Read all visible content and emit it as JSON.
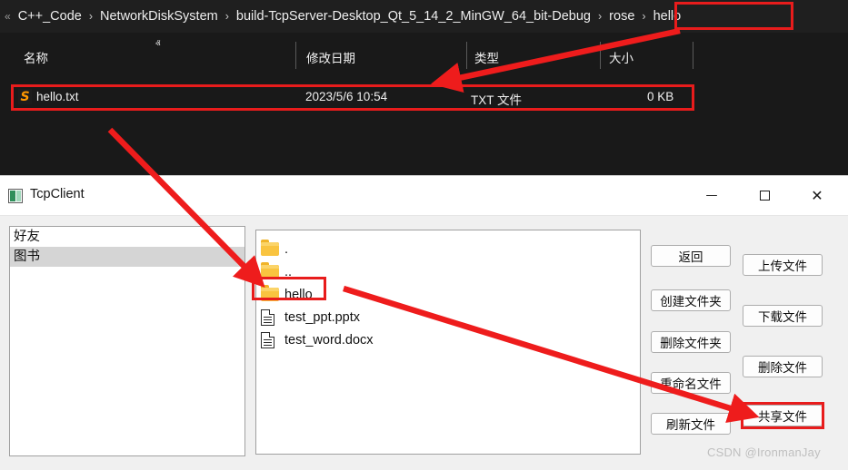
{
  "explorer": {
    "breadcrumb": {
      "overflow_glyph": "«",
      "segments": [
        "C++_Code",
        "NetworkDiskSystem",
        "build-TcpServer-Desktop_Qt_5_14_2_MinGW_64_bit-Debug",
        "rose",
        "hello"
      ],
      "separator": "›"
    },
    "columns": [
      {
        "label": "名称"
      },
      {
        "label": "修改日期"
      },
      {
        "label": "类型"
      },
      {
        "label": "大小"
      }
    ],
    "sort_indicator": "ⱏ",
    "rows": [
      {
        "icon": "sublime-text-file-icon",
        "icon_glyph": "S",
        "name": "hello.txt",
        "modified": "2023/5/6 10:54",
        "type": "TXT 文件",
        "size": "0 KB"
      }
    ]
  },
  "window": {
    "title": "TcpClient",
    "icon": "tcpclient-app-icon",
    "controls": {
      "minimize": "—",
      "maximize": "",
      "close": "✕"
    }
  },
  "friend_list": {
    "items": [
      {
        "label": "好友",
        "selected": false
      },
      {
        "label": "图书",
        "selected": true
      }
    ]
  },
  "file_list": {
    "items": [
      {
        "name": ".",
        "kind": "folder"
      },
      {
        "name": "..",
        "kind": "folder"
      },
      {
        "name": "hello",
        "kind": "folder",
        "highlighted": true
      },
      {
        "name": "test_ppt.pptx",
        "kind": "document"
      },
      {
        "name": "test_word.docx",
        "kind": "document"
      }
    ]
  },
  "buttons": {
    "left_column": [
      {
        "label": "返回"
      },
      {
        "label": "创建文件夹"
      },
      {
        "label": "删除文件夹"
      },
      {
        "label": "重命名文件"
      },
      {
        "label": "刷新文件"
      }
    ],
    "right_column": [
      {
        "label": "上传文件"
      },
      {
        "label": "下载文件"
      },
      {
        "label": "删除文件"
      },
      {
        "label": "共享文件",
        "highlighted": true
      }
    ]
  },
  "watermark": {
    "text": "CSDN @IronmanJay"
  },
  "annotation": {
    "highlight_color": "#e81c1c",
    "arrow_color": "#ee1c1c",
    "targets": [
      "breadcrumb-rose-hello",
      "explorer-hello-txt-row",
      "file-list-hello-folder",
      "share-file-button"
    ]
  }
}
